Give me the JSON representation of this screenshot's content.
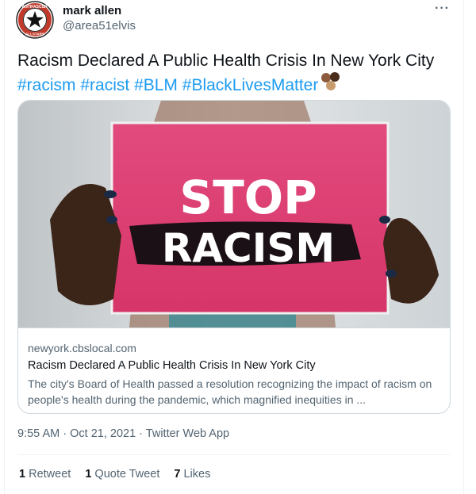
{
  "author": {
    "display_name": "mark allen",
    "handle": "@area51elvis",
    "avatar_text_top": "ANTIFASCIST",
    "avatar_text_bottom": "ALLSTARS"
  },
  "more_label": "···",
  "tweet": {
    "text": "Racism Declared A Public Health Crisis In New York City",
    "hashtags": [
      "#racism",
      "#racist",
      "#BLM",
      "#BlackLivesMatter"
    ]
  },
  "card": {
    "image_sign_line1": "STOP",
    "image_sign_line2": "RACISM",
    "domain": "newyork.cbslocal.com",
    "title": "Racism Declared A Public Health Crisis In New York City",
    "description": "The city's Board of Health passed a resolution recognizing the impact of racism on people's health during the pandemic, which magnified inequities in ..."
  },
  "meta": {
    "time": "9:55 AM",
    "date": "Oct 21, 2021",
    "source": "Twitter Web App",
    "separator": "·"
  },
  "stats": {
    "retweets_count": "1",
    "retweets_label": "Retweet",
    "quotes_count": "1",
    "quotes_label": "Quote Tweet",
    "likes_count": "7",
    "likes_label": "Likes"
  },
  "colors": {
    "link": "#1d9bf0",
    "secondary_text": "#536471",
    "sign_pink": "#e8417a"
  }
}
